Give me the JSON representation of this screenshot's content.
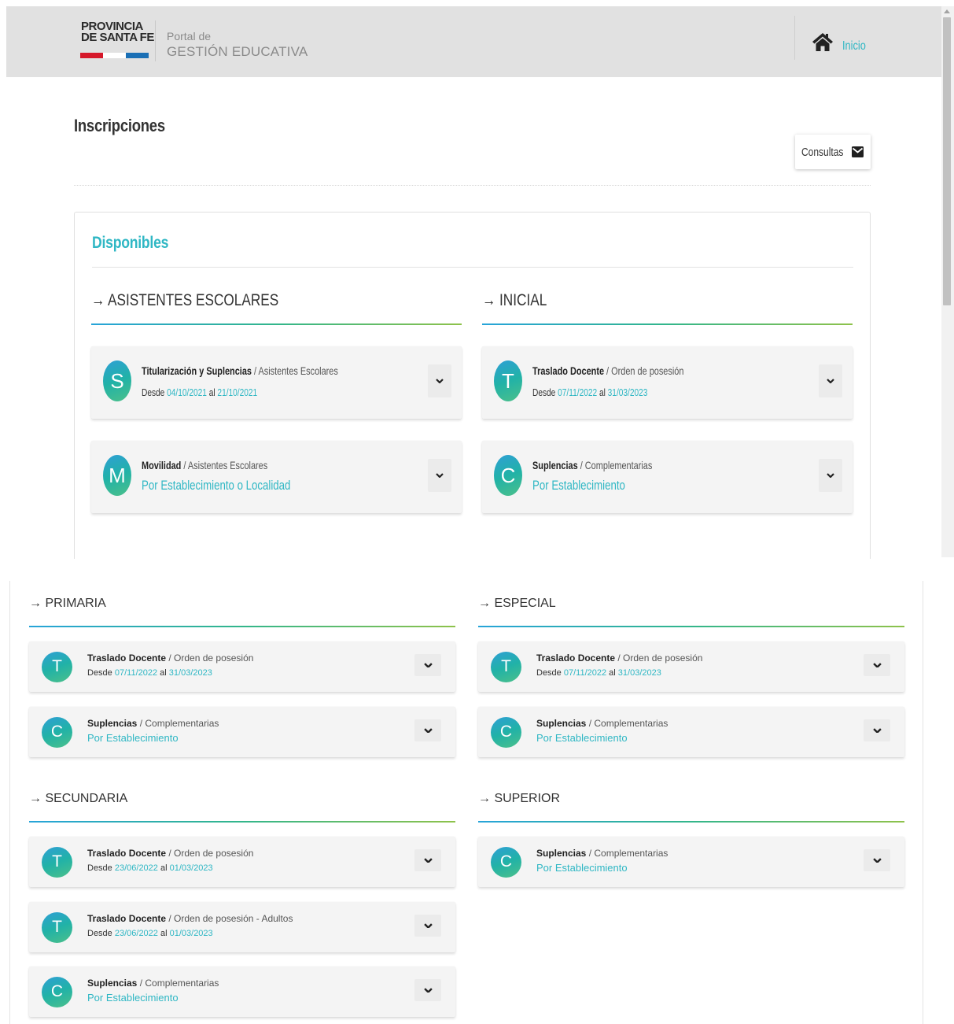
{
  "header": {
    "logo_line1": "PROVINCIA",
    "logo_line2": "DE SANTA FE",
    "portal_line1": "Portal de",
    "portal_line2": "GESTIÓN EDUCATIVA",
    "home_label": "Inicio"
  },
  "colors": {
    "accent": "#2fb7c4",
    "flag_red": "#d6182a",
    "flag_white": "#ffffff",
    "flag_blue": "#1a6fb5"
  },
  "page": {
    "title": "Inscripciones",
    "consultas_label": "Consultas",
    "panel_title": "Disponibles"
  },
  "sections_top": [
    {
      "heading": "→ ASISTENTES ESCOLARES",
      "cards": [
        {
          "letter": "S",
          "title_bold": "Titularización y Suplencias",
          "title_rest": " / Asistentes Escolares",
          "sub_type": "dates",
          "desde": "Desde ",
          "from": "04/10/2021",
          "al": " al ",
          "to": "21/10/2021"
        },
        {
          "letter": "M",
          "title_bold": "Movilidad",
          "title_rest": " / Asistentes Escolares",
          "sub_type": "link",
          "link": "Por Establecimiento o Localidad"
        }
      ]
    },
    {
      "heading": "→ INICIAL",
      "cards": [
        {
          "letter": "T",
          "title_bold": "Traslado Docente",
          "title_rest": " / Orden de posesión",
          "sub_type": "dates",
          "desde": "Desde ",
          "from": "07/11/2022",
          "al": " al ",
          "to": "31/03/2023"
        },
        {
          "letter": "C",
          "title_bold": "Suplencias",
          "title_rest": " / Complementarias",
          "sub_type": "link",
          "link": "Por Establecimiento"
        }
      ]
    }
  ],
  "sections_bottom": [
    {
      "heading": "→ PRIMARIA",
      "cards": [
        {
          "letter": "T",
          "title_bold": "Traslado Docente",
          "title_rest": " / Orden de posesión",
          "sub_type": "dates",
          "desde": "Desde ",
          "from": "07/11/2022",
          "al": " al ",
          "to": "31/03/2023"
        },
        {
          "letter": "C",
          "title_bold": "Suplencias",
          "title_rest": " / Complementarias",
          "sub_type": "link",
          "link": "Por Establecimiento"
        }
      ]
    },
    {
      "heading": "→ ESPECIAL",
      "cards": [
        {
          "letter": "T",
          "title_bold": "Traslado Docente",
          "title_rest": " / Orden de posesión",
          "sub_type": "dates",
          "desde": "Desde ",
          "from": "07/11/2022",
          "al": " al ",
          "to": "31/03/2023"
        },
        {
          "letter": "C",
          "title_bold": "Suplencias",
          "title_rest": " / Complementarias",
          "sub_type": "link",
          "link": "Por Establecimiento"
        }
      ]
    },
    {
      "heading": "→ SECUNDARIA",
      "cards": [
        {
          "letter": "T",
          "title_bold": "Traslado Docente",
          "title_rest": " / Orden de posesión",
          "sub_type": "dates",
          "desde": "Desde ",
          "from": "23/06/2022",
          "al": " al ",
          "to": "01/03/2023"
        },
        {
          "letter": "T",
          "title_bold": "Traslado Docente",
          "title_rest": " / Orden de posesión - Adultos",
          "sub_type": "dates",
          "desde": "Desde ",
          "from": "23/06/2022",
          "al": " al ",
          "to": "01/03/2023"
        },
        {
          "letter": "C",
          "title_bold": "Suplencias",
          "title_rest": " / Complementarias",
          "sub_type": "link",
          "link": "Por Establecimiento"
        }
      ]
    },
    {
      "heading": "→ SUPERIOR",
      "cards": [
        {
          "letter": "C",
          "title_bold": "Suplencias",
          "title_rest": " / Complementarias",
          "sub_type": "link",
          "link": "Por Establecimiento"
        }
      ]
    }
  ]
}
